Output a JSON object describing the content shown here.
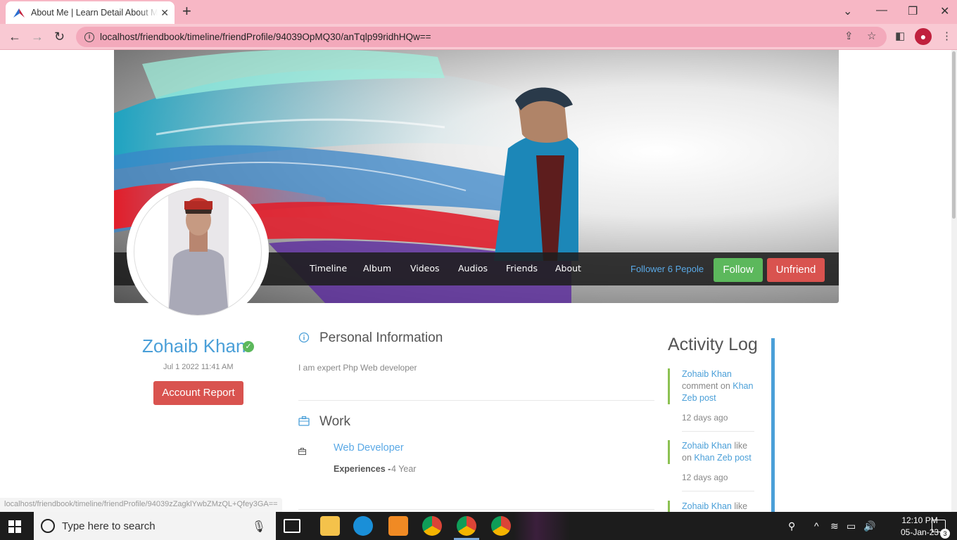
{
  "browser": {
    "tab_title": "About Me | Learn Detail About Me",
    "url": "localhost/friendbook/timeline/friendProfile/94039OpMQ30/anTqlp99ridhHQw==",
    "status_url": "localhost/friendbook/timeline/friendProfile/94039zZagklYwbZMzQL+Qfey3GA=="
  },
  "profile": {
    "nav": [
      "Timeline",
      "Album",
      "Videos",
      "Audios",
      "Friends",
      "About"
    ],
    "follower_text": "Follower 6 Pepole",
    "follow_label": "Follow",
    "unfriend_label": "Unfriend",
    "name": "Zohaib Khan",
    "joined": "Jul 1 2022 11:41 AM",
    "report_label": "Account Report"
  },
  "personal": {
    "title": "Personal Information",
    "text": "I am expert Php Web developer"
  },
  "work": {
    "title": "Work",
    "role": "Web Developer",
    "exp_label": "Experiences -",
    "exp_value": "4 Year"
  },
  "activity": {
    "title": "Activity Log",
    "items": [
      {
        "user": "Zohaib Khan",
        "action": "comment on",
        "target": "Khan Zeb post",
        "time": "12 days ago"
      },
      {
        "user": "Zohaib Khan",
        "action": "like on",
        "target": "Khan Zeb post",
        "time": "12 days ago"
      },
      {
        "user": "Zohaib Khan",
        "action": "like",
        "target": "",
        "time": ""
      }
    ]
  },
  "taskbar": {
    "search_placeholder": "Type here to search",
    "time": "12:10 PM",
    "date": "05-Jan-23",
    "notifications": "3"
  },
  "colors": {
    "accent": "#4a9fd8",
    "follow": "#5cb85c",
    "danger": "#d9534f",
    "chrome_tabbar": "#f7b7c5"
  }
}
